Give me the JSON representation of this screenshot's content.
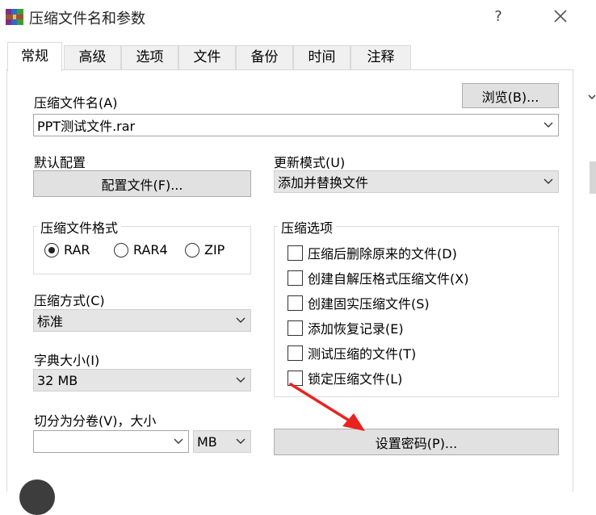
{
  "window": {
    "title": "压缩文件名和参数",
    "help_label": "?",
    "close_icon": "close-icon"
  },
  "tabs": [
    {
      "label": "常规",
      "active": true
    },
    {
      "label": "高级",
      "active": false
    },
    {
      "label": "选项",
      "active": false
    },
    {
      "label": "文件",
      "active": false
    },
    {
      "label": "备份",
      "active": false
    },
    {
      "label": "时间",
      "active": false
    },
    {
      "label": "注释",
      "active": false
    }
  ],
  "archive_name": {
    "label": "压缩文件名(A)",
    "value": "PPT测试文件.rar",
    "browse_label": "浏览(B)..."
  },
  "default_profile": {
    "label": "默认配置",
    "button_label": "配置文件(F)..."
  },
  "update_mode": {
    "label": "更新模式(U)",
    "value": "添加并替换文件"
  },
  "format": {
    "label": "压缩文件格式",
    "options": [
      {
        "label": "RAR",
        "checked": true
      },
      {
        "label": "RAR4",
        "checked": false
      },
      {
        "label": "ZIP",
        "checked": false
      }
    ]
  },
  "compression_method": {
    "label": "压缩方式(C)",
    "value": "标准"
  },
  "dictionary_size": {
    "label": "字典大小(I)",
    "value": "32 MB"
  },
  "split_volumes": {
    "label": "切分为分卷(V)，大小",
    "value": "",
    "unit": "MB"
  },
  "archiving_options": {
    "label": "压缩选项",
    "items": [
      {
        "label": "压缩后删除原来的文件(D)",
        "checked": false
      },
      {
        "label": "创建自解压格式压缩文件(X)",
        "checked": false
      },
      {
        "label": "创建固实压缩文件(S)",
        "checked": false
      },
      {
        "label": "添加恢复记录(E)",
        "checked": false
      },
      {
        "label": "测试压缩的文件(T)",
        "checked": false
      },
      {
        "label": "锁定压缩文件(L)",
        "checked": false
      }
    ]
  },
  "set_password_label": "设置密码(P)...",
  "colors": {
    "accent_arrow": "#e8231f",
    "button_bg": "#e1e1e1",
    "tab_bg": "#f0f0f0"
  }
}
